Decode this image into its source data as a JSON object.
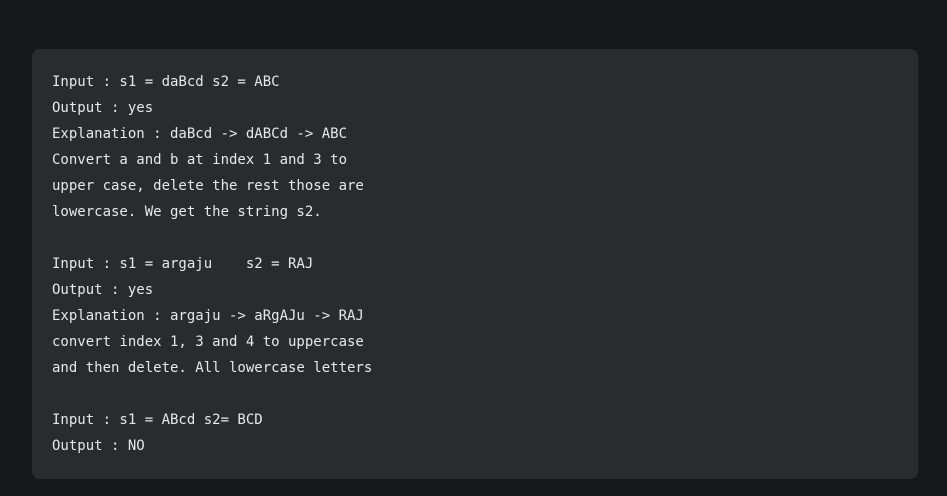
{
  "code_block": {
    "lines": [
      "Input : s1 = daBcd s2 = ABC",
      "Output : yes",
      "Explanation : daBcd -> dABCd -> ABC",
      "Convert a and b at index 1 and 3 to",
      "upper case, delete the rest those are",
      "lowercase. We get the string s2.",
      "",
      "Input : s1 = argaju    s2 = RAJ",
      "Output : yes",
      "Explanation : argaju -> aRgAJu -> RAJ",
      "convert index 1, 3 and 4 to uppercase",
      "and then delete. All lowercase letters",
      "",
      "Input : s1 = ABcd s2= BCD",
      "Output : NO"
    ]
  }
}
